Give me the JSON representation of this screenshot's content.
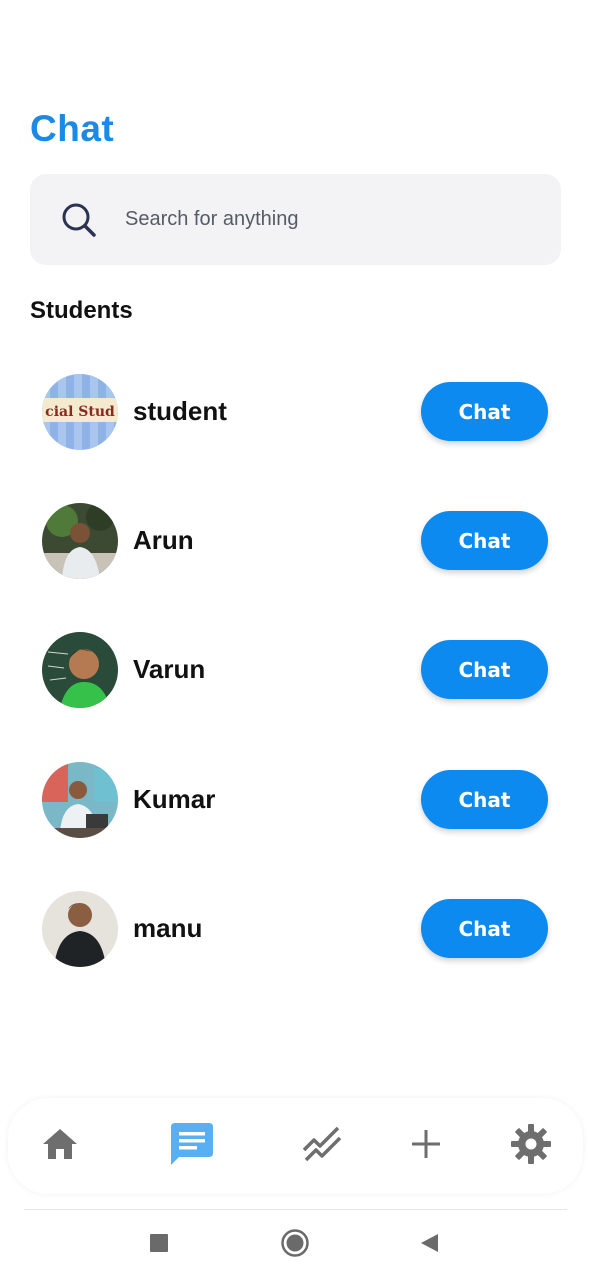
{
  "header": {
    "title": "Chat"
  },
  "search": {
    "placeholder": "Search for anything"
  },
  "section": {
    "title": "Students"
  },
  "students": [
    {
      "name": "student",
      "button_label": "Chat",
      "avatar": "social-studies-banner"
    },
    {
      "name": "Arun",
      "button_label": "Chat",
      "avatar": "photo-man-at-desk"
    },
    {
      "name": "Varun",
      "button_label": "Chat",
      "avatar": "photo-boy-smiling"
    },
    {
      "name": "Kumar",
      "button_label": "Chat",
      "avatar": "photo-man-with-laptop"
    },
    {
      "name": "manu",
      "button_label": "Chat",
      "avatar": "photo-man-dark-shirt"
    }
  ],
  "avatar_text": {
    "banner": "cial Stud"
  },
  "bottom_nav": {
    "items": [
      {
        "icon": "home-icon",
        "active": false
      },
      {
        "icon": "chat-message-icon",
        "active": true
      },
      {
        "icon": "trending-icon",
        "active": false
      },
      {
        "icon": "add-icon",
        "active": false
      },
      {
        "icon": "settings-gear-icon",
        "active": false
      }
    ]
  },
  "system_nav": {
    "icons": [
      "recent-apps-icon",
      "home-circle-icon",
      "back-triangle-icon"
    ]
  },
  "colors": {
    "accent": "#1a8ae6",
    "button": "#0c8af0",
    "nav_active": "#5aaef2",
    "nav_inactive": "#6e6e6e",
    "search_bg": "#f3f3f6"
  }
}
